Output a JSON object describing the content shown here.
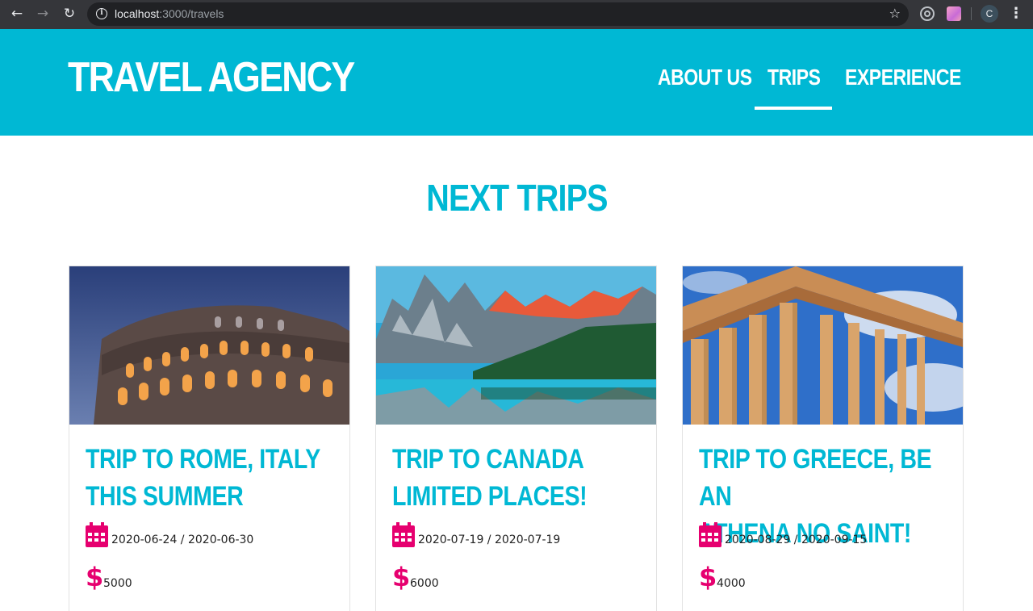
{
  "browser": {
    "url_host": "localhost",
    "url_path": ":3000/travels",
    "profile_initial": "C"
  },
  "site": {
    "brand": "TRAVEL AGENCY",
    "nav": [
      {
        "label": "ABOUT US",
        "active": false
      },
      {
        "label": "TRIPS",
        "active": true
      },
      {
        "label": "EXPERIENCE",
        "active": false
      }
    ]
  },
  "main": {
    "title": "NEXT TRIPS",
    "trips": [
      {
        "title_line1": "TRIP TO ROME, ITALY",
        "title_line2": "THIS SUMMER",
        "dates": "2020-06-24 / 2020-06-30",
        "price": "5000",
        "image": "colosseum"
      },
      {
        "title_line1": "TRIP TO CANADA",
        "title_line2": "LIMITED PLACES!",
        "dates": "2020-07-19 / 2020-07-19",
        "price": "6000",
        "image": "mountain-lake"
      },
      {
        "title_line1": "TRIP TO GREECE, BE AN",
        "title_line2": "ATHENA NO SAINT!",
        "dates": "2020-08-29 / 2020-09-15",
        "price": "4000",
        "image": "parthenon"
      }
    ]
  },
  "colors": {
    "brand": "#00b8d4",
    "accent": "#e6006f",
    "header_text": "#ffffff"
  },
  "icons": {
    "back": "arrow-left-icon",
    "forward": "arrow-right-icon",
    "reload": "reload-icon",
    "info": "info-icon",
    "bookmark": "star-icon",
    "date": "calendar-icon",
    "price": "dollar-icon"
  }
}
